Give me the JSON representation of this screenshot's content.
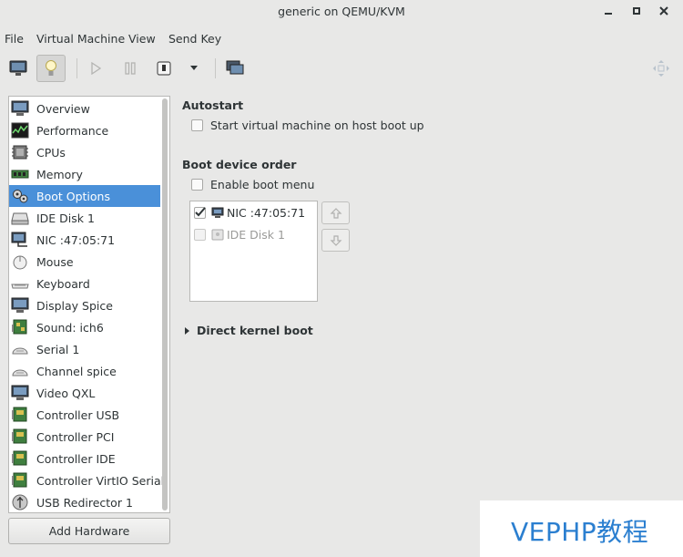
{
  "window": {
    "title": "generic on QEMU/KVM"
  },
  "menubar": {
    "items": [
      "File",
      "Virtual Machine",
      "View",
      "Send Key"
    ]
  },
  "toolbar": {
    "buttons": [
      "monitor-icon",
      "lightbulb-icon",
      "play-icon",
      "pause-icon",
      "power-icon",
      "dropdown-arrow-icon",
      "screens-icon",
      "fullscreen-icon"
    ]
  },
  "sidebar": {
    "items": [
      {
        "label": "Overview",
        "icon": "monitor-icon"
      },
      {
        "label": "Performance",
        "icon": "graph-icon"
      },
      {
        "label": "CPUs",
        "icon": "cpu-icon"
      },
      {
        "label": "Memory",
        "icon": "memory-icon"
      },
      {
        "label": "Boot Options",
        "icon": "gears-icon",
        "selected": true
      },
      {
        "label": "IDE Disk 1",
        "icon": "disk-icon"
      },
      {
        "label": "NIC :47:05:71",
        "icon": "network-icon"
      },
      {
        "label": "Mouse",
        "icon": "mouse-icon"
      },
      {
        "label": "Keyboard",
        "icon": "keyboard-icon"
      },
      {
        "label": "Display Spice",
        "icon": "display-icon"
      },
      {
        "label": "Sound: ich6",
        "icon": "sound-card-icon"
      },
      {
        "label": "Serial 1",
        "icon": "serial-icon"
      },
      {
        "label": "Channel spice",
        "icon": "channel-icon"
      },
      {
        "label": "Video QXL",
        "icon": "video-icon"
      },
      {
        "label": "Controller USB",
        "icon": "controller-icon"
      },
      {
        "label": "Controller PCI",
        "icon": "controller-icon"
      },
      {
        "label": "Controller IDE",
        "icon": "controller-icon"
      },
      {
        "label": "Controller VirtIO Serial",
        "icon": "controller-icon"
      },
      {
        "label": "USB Redirector 1",
        "icon": "usb-icon"
      }
    ],
    "add_hardware_label": "Add Hardware"
  },
  "autostart": {
    "title": "Autostart",
    "checkbox_label": "Start virtual machine on host boot up",
    "checked": false
  },
  "boot": {
    "title": "Boot device order",
    "enable_menu_label": "Enable boot menu",
    "enable_menu_checked": false,
    "devices": [
      {
        "label": "NIC :47:05:71",
        "checked": true,
        "enabled": true
      },
      {
        "label": "IDE Disk 1",
        "checked": false,
        "enabled": false
      }
    ]
  },
  "direct_kernel_boot": {
    "label": "Direct kernel boot"
  },
  "watermark": {
    "text": "VEPHP教程"
  },
  "colors": {
    "selection": "#4a90d9",
    "background": "#e8e8e7",
    "watermark": "#2b7fd0"
  }
}
